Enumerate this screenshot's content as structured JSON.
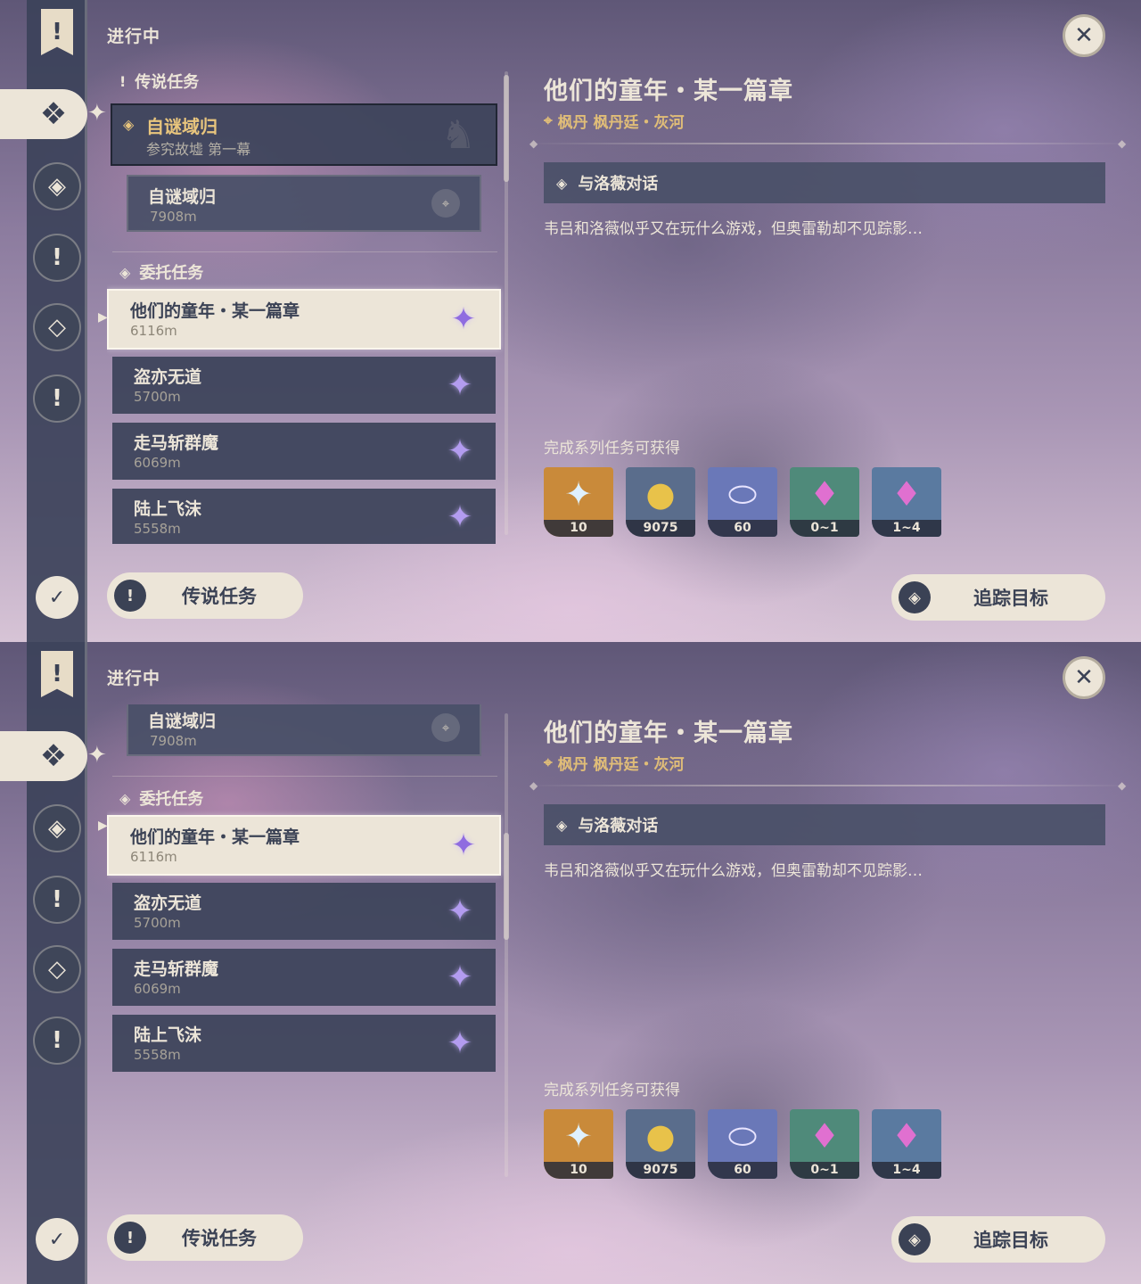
{
  "header": {
    "status": "进行中"
  },
  "sidebar": {
    "top_icon": "quest-banner-icon",
    "items": [
      {
        "name": "all-quests",
        "glyph": "❖",
        "active": true
      },
      {
        "name": "archon-quests",
        "glyph": "◈"
      },
      {
        "name": "story-quests",
        "glyph": "!"
      },
      {
        "name": "world-quests",
        "glyph": "◇"
      },
      {
        "name": "event-quests",
        "glyph": "!"
      }
    ],
    "bottom_icon": "quest-settings-icon"
  },
  "sections": {
    "legend": "传说任务",
    "commission": "委托任务"
  },
  "legend_quest": {
    "title": "自谜域归",
    "subtitle": "参究故墟 第一幕"
  },
  "legend_sub": {
    "title": "自谜域归",
    "distance": "7908m"
  },
  "quests": [
    {
      "title": "他们的童年・某一篇章",
      "distance": "6116m"
    },
    {
      "title": "盗亦无道",
      "distance": "5700m"
    },
    {
      "title": "走马斩群魔",
      "distance": "6069m"
    },
    {
      "title": "陆上飞沫",
      "distance": "5558m"
    }
  ],
  "detail": {
    "title": "他们的童年・某一篇章",
    "location": "枫丹 枫丹廷・灰河",
    "objective": "与洛薇对话",
    "description": "韦吕和洛薇似乎又在玩什么游戏，但奥雷勒却不见踪影…",
    "rewards_title": "完成系列任务可获得",
    "rewards": [
      {
        "name": "primogem",
        "qty": "10",
        "bg": "#c98a3a",
        "glyph": "✦",
        "color": "#dff1ff"
      },
      {
        "name": "mora",
        "qty": "9075",
        "bg": "#5a6d8c",
        "glyph": "●",
        "color": "#e8c24a"
      },
      {
        "name": "companionship-exp",
        "qty": "60",
        "bg": "#6a78b8",
        "glyph": "⬭",
        "color": "#e8e4ff"
      },
      {
        "name": "crystal-chunk",
        "qty": "0~1",
        "bg": "#4f8a7a",
        "glyph": "♦",
        "color": "#e070d0"
      },
      {
        "name": "crystal-cluster",
        "qty": "1~4",
        "bg": "#5a7aa0",
        "glyph": "♦",
        "color": "#e070d0"
      }
    ]
  },
  "buttons": {
    "legend": "传说任务",
    "track": "追踪目标"
  }
}
